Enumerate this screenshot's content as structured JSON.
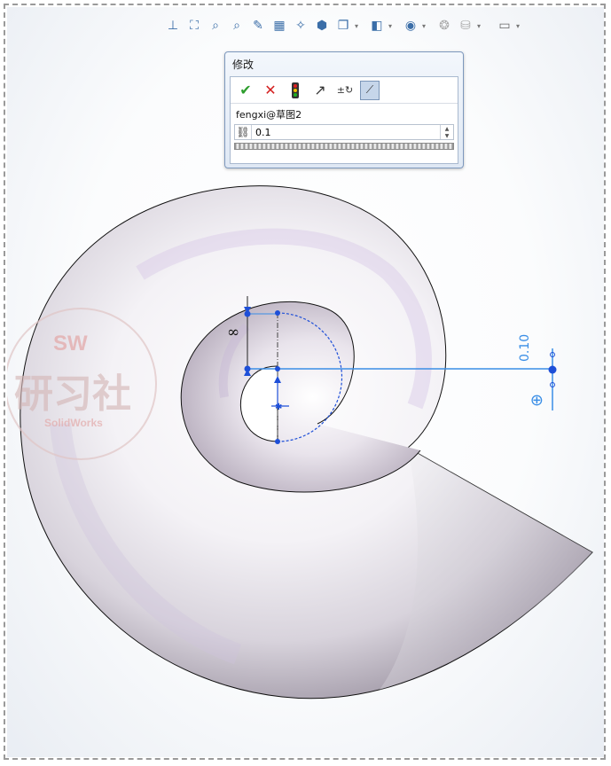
{
  "dialog": {
    "title": "修改",
    "sketch_name": "fengxi@草图2",
    "value": "0.1",
    "tools": [
      {
        "name": "ok-check-icon"
      },
      {
        "name": "cancel-x-icon"
      },
      {
        "name": "rebuild-traffic-light-icon"
      },
      {
        "name": "reset-value-icon"
      },
      {
        "name": "mark-driven-dimension-icon"
      },
      {
        "name": "spin-increment-icon"
      }
    ]
  },
  "dimensions": {
    "vertical_label": "∞",
    "right_label": "0.10",
    "right_symbol": "⊕"
  },
  "watermark": {
    "line1": "SW",
    "line2": "研习社",
    "line3": "SolidWorks"
  },
  "colors": {
    "accent_blue": "#3a8ee6",
    "sketch_blue": "#1e4fd8",
    "dialog_border": "#7d98bd"
  }
}
